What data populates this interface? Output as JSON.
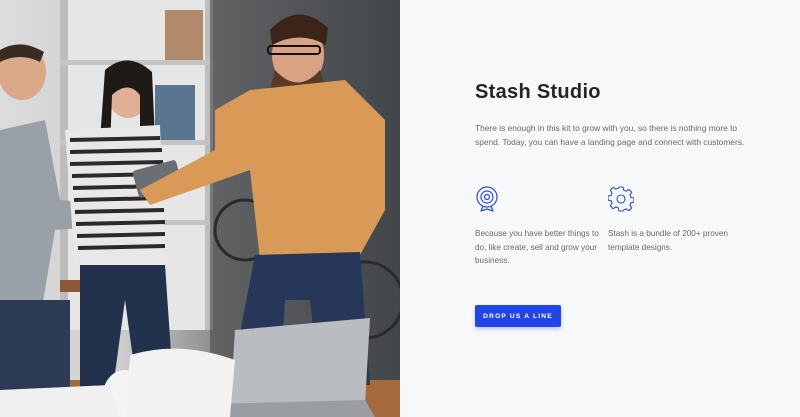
{
  "hero": {
    "title": "Stash Studio",
    "intro": "There is enough in this kit to grow with you, so there is nothing more to spend. Today, you can have a landing page and connect with customers."
  },
  "features": [
    {
      "icon": "target-icon",
      "text": "Because you have better things to do, like create, sell and grow your business."
    },
    {
      "icon": "gear-icon",
      "text": "Stash is a bundle of 200+ proven template designs."
    }
  ],
  "cta": {
    "label": "DROP US A LINE"
  },
  "colors": {
    "accent": "#2245e8",
    "icon_stroke": "#2b4dd6",
    "background": "#f7f8fa",
    "heading": "#252525",
    "body_text": "#666a70"
  }
}
